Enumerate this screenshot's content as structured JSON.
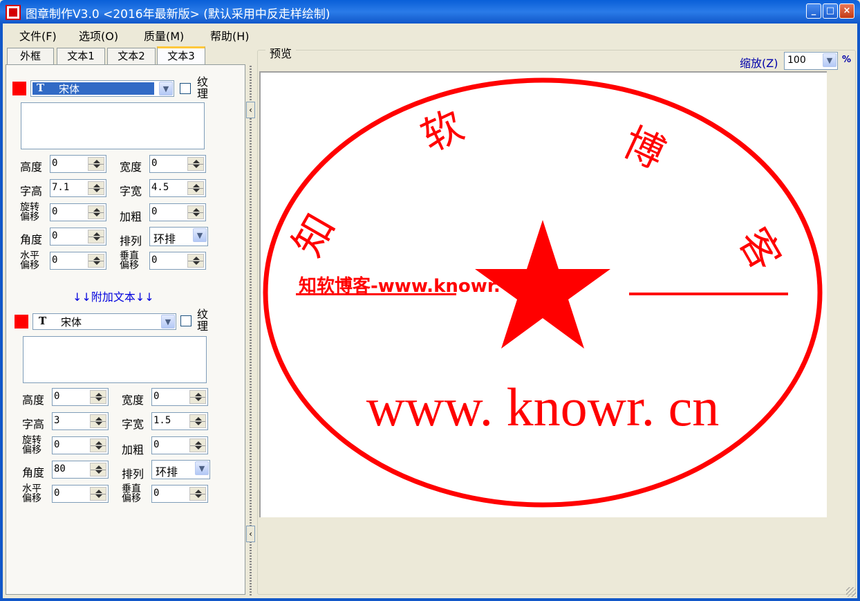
{
  "window": {
    "title": "图章制作V3.0 <2016年最新版> (默认采用中反走样绘制)",
    "controls": [
      "minimize",
      "maximize",
      "close"
    ]
  },
  "menu": [
    {
      "label": "文件(F)"
    },
    {
      "label": "选项(O)"
    },
    {
      "label": "质量(M)"
    },
    {
      "label": "帮助(H)"
    }
  ],
  "tabs": [
    {
      "label": "外框",
      "active": false
    },
    {
      "label": "文本1",
      "active": false
    },
    {
      "label": "文本2",
      "active": false
    },
    {
      "label": "文本3",
      "active": true
    }
  ],
  "text_section": {
    "color": "#ff0000",
    "font": "宋体",
    "texture_label": "纹理",
    "text_value": "",
    "fields": {
      "height_label": "高度",
      "height": "0",
      "width_label": "宽度",
      "width": "0",
      "char_height_label": "字高",
      "char_height": "7.1",
      "char_width_label": "字宽",
      "char_width": "4.5",
      "rotate_offset_label": "旋转偏移",
      "rotate_offset": "0",
      "bold_label": "加粗",
      "bold": "0",
      "angle_label": "角度",
      "angle": "0",
      "arrange_label": "排列",
      "arrange": "环排",
      "h_offset_label": "水平偏移",
      "h_offset": "0",
      "v_offset_label": "垂直偏移",
      "v_offset": "0"
    }
  },
  "extra_link": "↓↓附加文本↓↓",
  "extra_section": {
    "color": "#ff0000",
    "font": "宋体",
    "texture_label": "纹理",
    "text_value": "",
    "fields": {
      "height_label": "高度",
      "height": "0",
      "width_label": "宽度",
      "width": "0",
      "char_height_label": "字高",
      "char_height": "3",
      "char_width_label": "字宽",
      "char_width": "1.5",
      "rotate_offset_label": "旋转偏移",
      "rotate_offset": "0",
      "bold_label": "加粗",
      "bold": "0",
      "angle_label": "角度",
      "angle": "80",
      "arrange_label": "排列",
      "arrange": "环排",
      "h_offset_label": "水平偏移",
      "h_offset": "0",
      "v_offset_label": "垂直偏移",
      "v_offset": "0"
    }
  },
  "preview": {
    "legend": "预览",
    "zoom_label": "缩放(Z)",
    "zoom_value": "100",
    "zoom_unit": "%",
    "stamp": {
      "color": "#ff0000",
      "arc_chars": [
        "知",
        "软",
        "博",
        "客"
      ],
      "bottom_text": "www. knowr. cn"
    },
    "watermark": "知软博客-www.knowr.cn"
  }
}
